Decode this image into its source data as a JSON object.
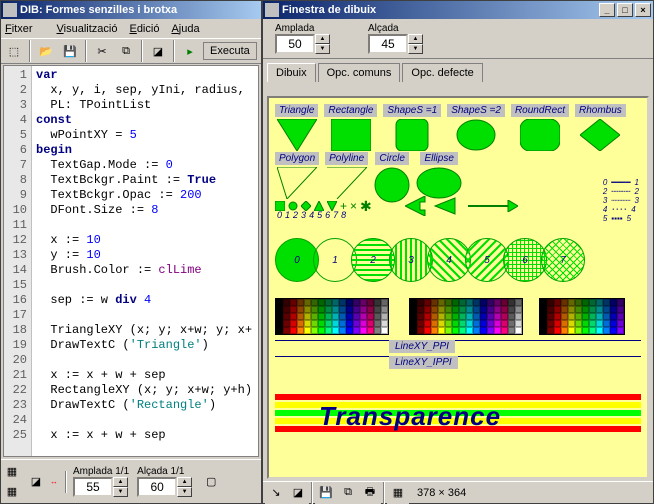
{
  "left": {
    "title": "DIB: Formes senzilles i brotxa",
    "menu": {
      "file": "Fitxer",
      "view": "Visualització",
      "edit": "Edició",
      "help": "Ajuda"
    },
    "execute": "Executa",
    "code_lines": [
      "var",
      "  x, y, i, sep, yIni, radius,",
      "  PL: TPointList",
      "const",
      "  wPointXY = 5",
      "begin",
      "  TextGap.Mode := 0",
      "  TextBckgr.Paint := True",
      "  TextBckgr.Opac := 200",
      "  DFont.Size := 8",
      "",
      "  x := 10",
      "  y := 10",
      "  Brush.Color := clLime",
      "",
      "  sep := w div 4",
      "",
      "  TriangleXY (x; y; x+w; y; x+",
      "  DrawTextC ('Triangle')",
      "",
      "  x := x + w + sep",
      "  RectangleXY (x; y; x+w; y+h)",
      "  DrawTextC ('Rectangle')",
      "",
      "  x := x + w + sep"
    ],
    "bottom": {
      "amplada_label": "Amplada 1/1",
      "alcada_label": "Alçada 1/1",
      "amplada": "55",
      "alcada": "60"
    }
  },
  "right": {
    "title": "Finestra de dibuix",
    "amplada_label": "Amplada",
    "alcada_label": "Alçada",
    "amplada": "50",
    "alcada": "45",
    "tabs": {
      "dibuix": "Dibuix",
      "comuns": "Opc. comuns",
      "defecte": "Opc. defecte"
    },
    "shapes": {
      "triangle": "Triangle",
      "rectangle": "Rectangle",
      "shapes1": "ShapeS =1",
      "shapes2": "ShapeS =2",
      "roundrect": "RoundRect",
      "rhombus": "Rhombus",
      "polygon": "Polygon",
      "polyline": "Polyline",
      "circle": "Circle",
      "ellipse": "Ellipse"
    },
    "linexy_ppi": "LineXY_PPI",
    "linexy_ippi": "LineXY_IPPI",
    "transparence": "Transparence",
    "status_dims": "378 × 364"
  }
}
